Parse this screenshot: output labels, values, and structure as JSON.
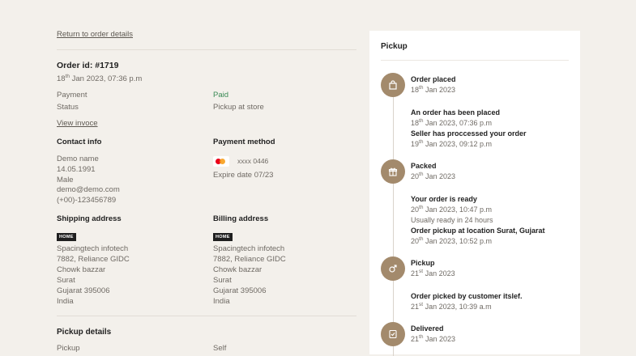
{
  "return_link": "Return to order details",
  "order": {
    "id_label": "Order id: #1719",
    "date_pre": "18",
    "date_sup": "th",
    "date_post": " Jan 2023, 07:36 p.m",
    "payment_label": "Payment",
    "payment_value": "Paid",
    "status_label": "Status",
    "status_value": "Pickup at store",
    "invoice_link": "View invoce"
  },
  "contact": {
    "title": "Contact info",
    "lines": [
      "Demo name",
      "14.05.1991",
      "Male",
      "demo@demo.com",
      "(+00)-123456789"
    ]
  },
  "payment_method": {
    "title": "Payment method",
    "card_number": "xxxx 0446",
    "expire": "Expire date 07/23"
  },
  "shipping": {
    "title": "Shipping address",
    "tag": "HOME",
    "lines": [
      "Spacingtech infotech",
      "7882, Reliance GIDC",
      "Chowk bazzar",
      "Surat",
      "Gujarat 395006",
      "India"
    ]
  },
  "billing": {
    "title": "Billing address",
    "tag": "HOME",
    "lines": [
      "Spacingtech infotech",
      "7882, Reliance GIDC",
      "Chowk bazzar",
      "Surat",
      "Gujarat 395006",
      "India"
    ]
  },
  "pickup_details": {
    "title": "Pickup details",
    "row_label": "Pickup",
    "row_value": "Self"
  },
  "timeline": {
    "title": "Pickup",
    "steps": [
      {
        "title": "Order placed",
        "d_pre": "18",
        "d_sup": "th",
        "d_post": " Jan 2023"
      },
      {
        "title": "Packed",
        "d_pre": "20",
        "d_sup": "th",
        "d_post": " Jan 2023"
      },
      {
        "title": "Pickup",
        "d_pre": "21",
        "d_sup": "st",
        "d_post": " Jan 2023"
      },
      {
        "title": "Delivered",
        "d_pre": "21",
        "d_sup": "th",
        "d_post": " Jan 2023"
      }
    ],
    "events": [
      {
        "title": "An order has been placed",
        "d_pre": "18",
        "d_sup": "th",
        "d_post": " Jan 2023, 07:36 p.m"
      },
      {
        "title": "Seller has proccessed your order",
        "d_pre": "19",
        "d_sup": "th",
        "d_post": " Jan 2023, 09:12 p.m"
      },
      {
        "title": "Your order is ready",
        "d_pre": "20",
        "d_sup": "th",
        "d_post": " Jan 2023, 10:47 p.m",
        "note": "Usually ready in 24 hours"
      },
      {
        "title": "Order pickup at location Surat, Gujarat",
        "d_pre": "20",
        "d_sup": "th",
        "d_post": " Jan 2023, 10:52 p.m"
      },
      {
        "title": "Order picked by customer itslef.",
        "d_pre": "21",
        "d_sup": "st",
        "d_post": " Jan 2023, 10:39 a.m"
      }
    ]
  }
}
